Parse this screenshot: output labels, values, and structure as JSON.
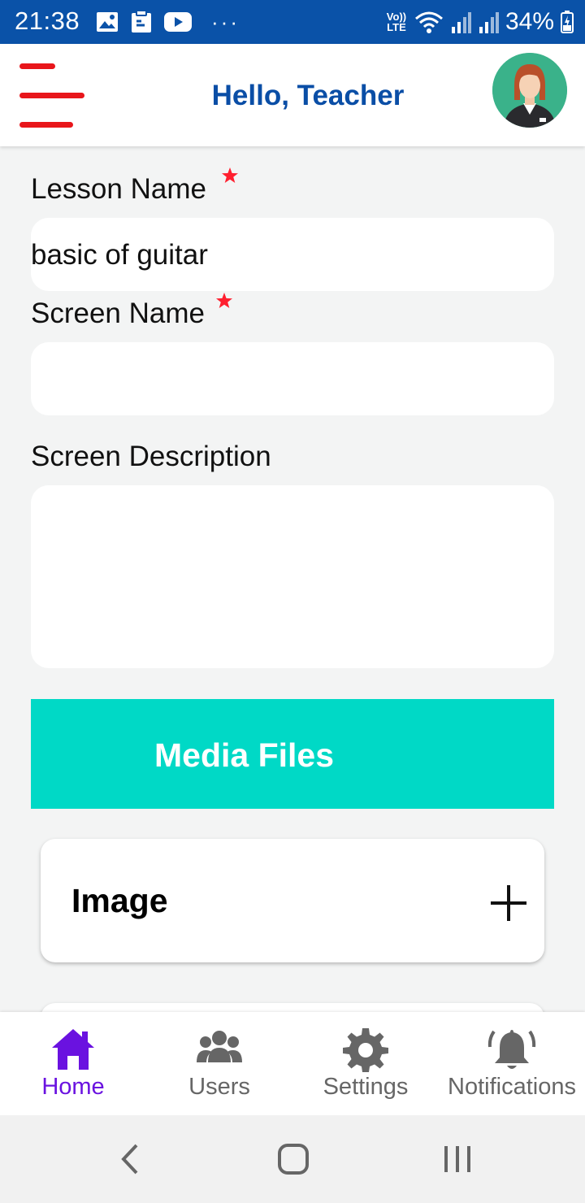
{
  "status_bar": {
    "time": "21:38",
    "more": "···",
    "network": "Vo)) LTE",
    "battery": "34%"
  },
  "header": {
    "greeting": "Hello, Teacher"
  },
  "form": {
    "lesson_name": {
      "label": "Lesson Name",
      "value": "basic of guitar",
      "required": true
    },
    "screen_name": {
      "label": "Screen Name",
      "value": "",
      "required": true
    },
    "screen_description": {
      "label": "Screen Description",
      "value": ""
    }
  },
  "media": {
    "title": "Media Files",
    "cards": [
      {
        "label": "Image",
        "action_icon": "plus-icon"
      }
    ]
  },
  "bottom_nav": {
    "items": [
      {
        "label": "Home",
        "icon": "home-icon",
        "active": true
      },
      {
        "label": "Users",
        "icon": "users-icon",
        "active": false
      },
      {
        "label": "Settings",
        "icon": "gear-icon",
        "active": false
      },
      {
        "label": "Notifications",
        "icon": "bell-icon",
        "active": false
      }
    ]
  },
  "colors": {
    "status_bar": "#0a52a8",
    "greeting": "#0a4ea6",
    "hamburger": "#e8161b",
    "media_bar": "#00d9c6",
    "nav_active": "#6a12e0",
    "nav_inactive": "#666666"
  }
}
